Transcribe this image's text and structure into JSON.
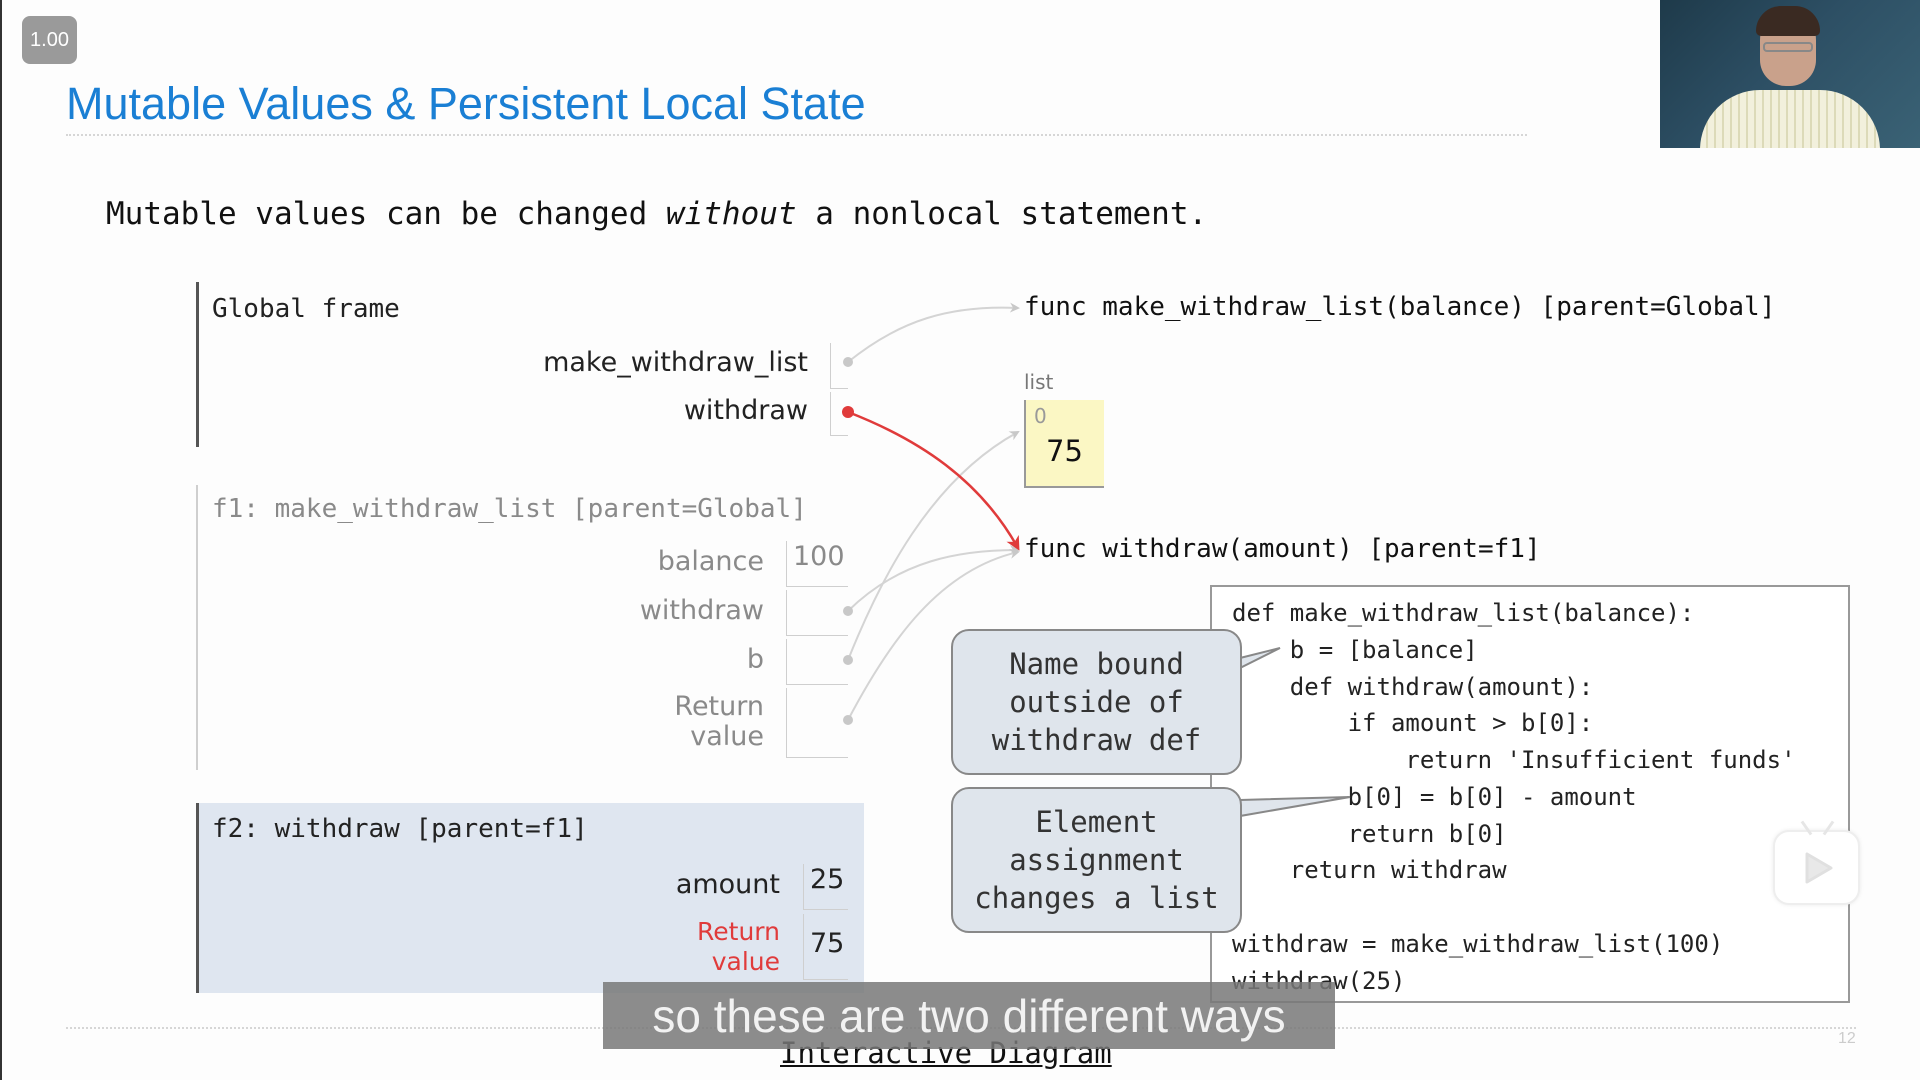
{
  "player": {
    "speed_badge": "1.00",
    "caption": "so these are two different ways",
    "play_button_icon": "play-icon",
    "page_number": "12"
  },
  "slide": {
    "title": "Mutable Values & Persistent Local State",
    "subtitle_before": "Mutable values can be changed ",
    "subtitle_emphasis": "without",
    "subtitle_after": " a nonlocal statement.",
    "footer_link": "Interactive Diagram"
  },
  "diagram": {
    "global_frame": {
      "title": "Global frame",
      "vars": [
        {
          "name": "make_withdraw_list",
          "value": "",
          "pointer": "gray"
        },
        {
          "name": "withdraw",
          "value": "",
          "pointer": "red"
        }
      ]
    },
    "f1_frame": {
      "title": "f1: make_withdraw_list [parent=Global]",
      "vars": [
        {
          "name": "balance",
          "value": "100"
        },
        {
          "name": "withdraw",
          "value": ""
        },
        {
          "name": "b",
          "value": ""
        },
        {
          "name": "Return value",
          "name_line1": "Return",
          "name_line2": "value",
          "value": ""
        }
      ]
    },
    "f2_frame": {
      "title": "f2: withdraw [parent=f1]",
      "vars": [
        {
          "name": "amount",
          "value": "25"
        },
        {
          "name": "Return value",
          "name_line1": "Return",
          "name_line2": "value",
          "value": "75"
        }
      ]
    },
    "objects": {
      "func_make_withdraw_list": "func make_withdraw_list(balance) [parent=Global]",
      "list_label": "list",
      "list_index": "0",
      "list_value": "75",
      "func_withdraw": "func withdraw(amount) [parent=f1]"
    },
    "colors": {
      "title_blue": "#1a7fd4",
      "active_pointer_red": "#e03b3b",
      "inactive_pointer_gray": "#c8c8c8",
      "list_fill": "#fbf7c4",
      "active_frame_fill": "#dfe6f0"
    }
  },
  "code": {
    "lines": [
      "def make_withdraw_list(balance):",
      "    b = [balance]",
      "    def withdraw(amount):",
      "        if amount > b[0]:",
      "            return 'Insufficient funds'",
      "        b[0] = b[0] - amount",
      "        return b[0]",
      "    return withdraw",
      "",
      "withdraw = make_withdraw_list(100)",
      "withdraw(25)"
    ]
  },
  "callouts": [
    {
      "line1": "Name bound",
      "line2": "outside of",
      "line3": "withdraw def"
    },
    {
      "line1": "Element",
      "line2": "assignment",
      "line3": "changes a list"
    }
  ]
}
